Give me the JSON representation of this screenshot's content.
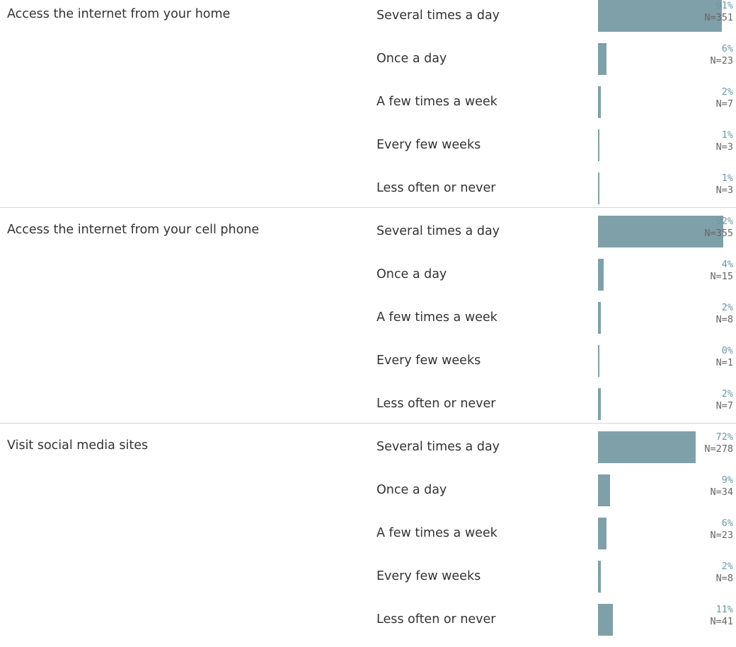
{
  "chart_data": {
    "type": "bar",
    "orientation": "horizontal",
    "xlim": [
      0,
      100
    ],
    "grid": false,
    "bar_color": "#7fa0a8",
    "pct_label_color": "#6a99a3",
    "n_label_color": "#666666",
    "groups": [
      {
        "label": "Access the internet from your home",
        "rows": [
          {
            "category": "Several times a day",
            "pct_value": 91,
            "pct_label": "91%",
            "n_label": "N=351"
          },
          {
            "category": "Once a day",
            "pct_value": 6,
            "pct_label": "6%",
            "n_label": "N=23"
          },
          {
            "category": "A few times a week",
            "pct_value": 2,
            "pct_label": "2%",
            "n_label": "N=7"
          },
          {
            "category": "Every few weeks",
            "pct_value": 1,
            "pct_label": "1%",
            "n_label": "N=3"
          },
          {
            "category": "Less often or never",
            "pct_value": 1,
            "pct_label": "1%",
            "n_label": "N=3"
          }
        ]
      },
      {
        "label": "Access the internet from your cell phone",
        "rows": [
          {
            "category": "Several times a day",
            "pct_value": 92,
            "pct_label": "92%",
            "n_label": "N=355"
          },
          {
            "category": "Once a day",
            "pct_value": 4,
            "pct_label": "4%",
            "n_label": "N=15"
          },
          {
            "category": "A few times a week",
            "pct_value": 2,
            "pct_label": "2%",
            "n_label": "N=8"
          },
          {
            "category": "Every few weeks",
            "pct_value": 0,
            "pct_label": "0%",
            "n_label": "N=1"
          },
          {
            "category": "Less often or never",
            "pct_value": 2,
            "pct_label": "2%",
            "n_label": "N=7"
          }
        ]
      },
      {
        "label": "Visit social media sites",
        "rows": [
          {
            "category": "Several times a day",
            "pct_value": 72,
            "pct_label": "72%",
            "n_label": "N=278"
          },
          {
            "category": "Once a day",
            "pct_value": 9,
            "pct_label": "9%",
            "n_label": "N=34"
          },
          {
            "category": "A few times a week",
            "pct_value": 6,
            "pct_label": "6%",
            "n_label": "N=23"
          },
          {
            "category": "Every few weeks",
            "pct_value": 2,
            "pct_label": "2%",
            "n_label": "N=8"
          },
          {
            "category": "Less often or never",
            "pct_value": 11,
            "pct_label": "11%",
            "n_label": "N=41"
          }
        ]
      }
    ]
  }
}
